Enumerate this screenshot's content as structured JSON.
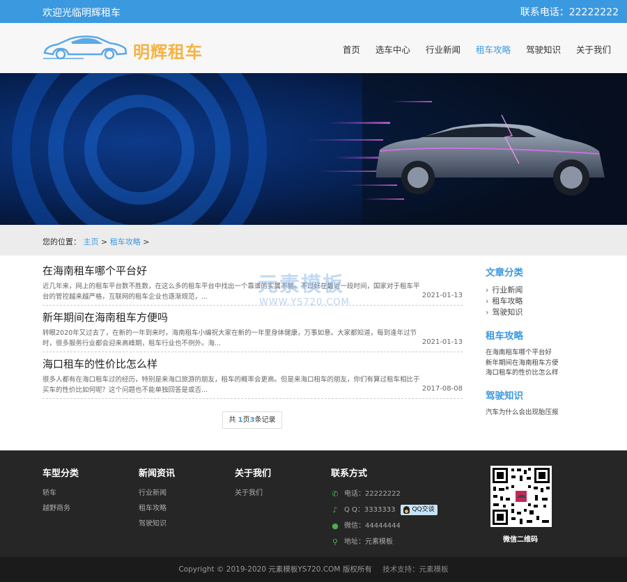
{
  "topbar": {
    "welcome": "欢迎光临明辉租车",
    "phone": "联系电话：22222222"
  },
  "header": {
    "logo_text": "明辉租车"
  },
  "nav": {
    "items": [
      "首页",
      "选车中心",
      "行业新闻",
      "租车攻略",
      "驾驶知识",
      "关于我们"
    ],
    "active": "租车攻略"
  },
  "breadcrumb": {
    "label": "您的位置：",
    "home": "主页",
    "sep1": " > ",
    "current": "租车攻略",
    "sep2": " >"
  },
  "articles": [
    {
      "title": "在海南租车哪个平台好",
      "desc": "近几年来，网上的租车平台数不胜数，在这么多的租车平台中找出一个靠谱的实属不易。不过好在最近一段时间，国家对于租车平台的管控越来越严格，互联网的租车企业也逐渐规范，...",
      "date": "2021-01-13"
    },
    {
      "title": "新年期间在海南租车方便吗",
      "desc": "转眼2020年又过去了，在新的一年到来时，海南租车小编祝大家在新的一年里身体健康，万事如意。大家都知道，每到逢年过节时，很多服务行业都会迎来高峰期，租车行业也不例外。海...",
      "date": "2021-01-13"
    },
    {
      "title": "海口租车的性价比怎么样",
      "desc": "很多人都有在海口租车过的经历，特别是来海口旅游的朋友，租车的概率会更高。但是来海口租车的朋友，你们有算过租车相比于买车的性价比如何呢？这个问题也不能单独回答是或否...",
      "date": "2017-08-08"
    }
  ],
  "watermark": {
    "line1": "元素模板",
    "line2": "WWW.YS720.COM"
  },
  "pager": {
    "prefix": "共 ",
    "page": "1",
    "mid": "页",
    "count": "3",
    "suffix": "条记录"
  },
  "sidebar": {
    "categories_title": "文章分类",
    "categories": [
      "行业新闻",
      "租车攻略",
      "驾驶知识"
    ],
    "guides_title": "租车攻略",
    "guides": [
      "在海南租车哪个平台好",
      "新年期间在海南租车方便",
      "海口租车的性价比怎么样"
    ],
    "driving_title": "驾驶知识",
    "driving": [
      "汽车为什么会出现胎压报"
    ]
  },
  "footer": {
    "col1": {
      "title": "车型分类",
      "items": [
        "轿车",
        "越野商务"
      ]
    },
    "col2": {
      "title": "新闻资讯",
      "items": [
        "行业新闻",
        "租车攻略",
        "驾驶知识"
      ]
    },
    "col3": {
      "title": "关于我们",
      "items": [
        "关于我们"
      ]
    },
    "contact": {
      "title": "联系方式",
      "phone": "电话：22222222",
      "qq": "Q Q：3333333",
      "qq_button": "QQ交谈",
      "wechat": "微信：44444444",
      "address": "地址：元素模板"
    },
    "qr_label": "微信二维码"
  },
  "copyright": {
    "text": "Copyright © 2019-2020 元素模板YS720.COM 版权所有",
    "tech": "技术支持：元素模板"
  },
  "colors": {
    "accent": "#3b99e0",
    "logo": "#f5b342",
    "footer": "#262626"
  }
}
